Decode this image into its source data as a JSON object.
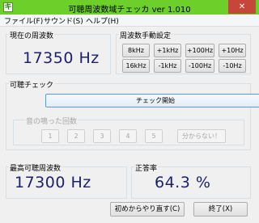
{
  "window": {
    "title": "可聴周波数域チェッカ ver 1.010",
    "icon_label": "キ",
    "close_symbol": "✕"
  },
  "menu": [
    "ファイル(F)",
    "サウンド(S)",
    "ヘルプ(H)"
  ],
  "current_freq": {
    "label": "現在の周波数",
    "value": "17350 Hz"
  },
  "manual": {
    "label": "周波数手動設定",
    "row1": [
      "8kHz",
      "+1kHz",
      "+100Hz",
      "+10Hz"
    ],
    "row2": [
      "16kHz",
      "-1kHz",
      "-100Hz",
      "-10Hz"
    ]
  },
  "hearing_check": {
    "label": "可聴チェック",
    "start_button": "チェック開始",
    "count_label": "音の鳴った回数",
    "count_buttons": [
      "1",
      "2",
      "3",
      "4",
      "5"
    ],
    "unknown_button": "分からない！"
  },
  "max_freq": {
    "label": "最高可聴周波数",
    "value": "17300 Hz"
  },
  "accuracy": {
    "label": "正答率",
    "value": "64.3 %"
  },
  "footer": {
    "reset_button": "初めからやり直す(C)",
    "exit_button": "終了(X)"
  },
  "colors": {
    "titlebar": "#6ccf2a",
    "value_text": "#1b1f6e",
    "close": "#c7463a"
  }
}
